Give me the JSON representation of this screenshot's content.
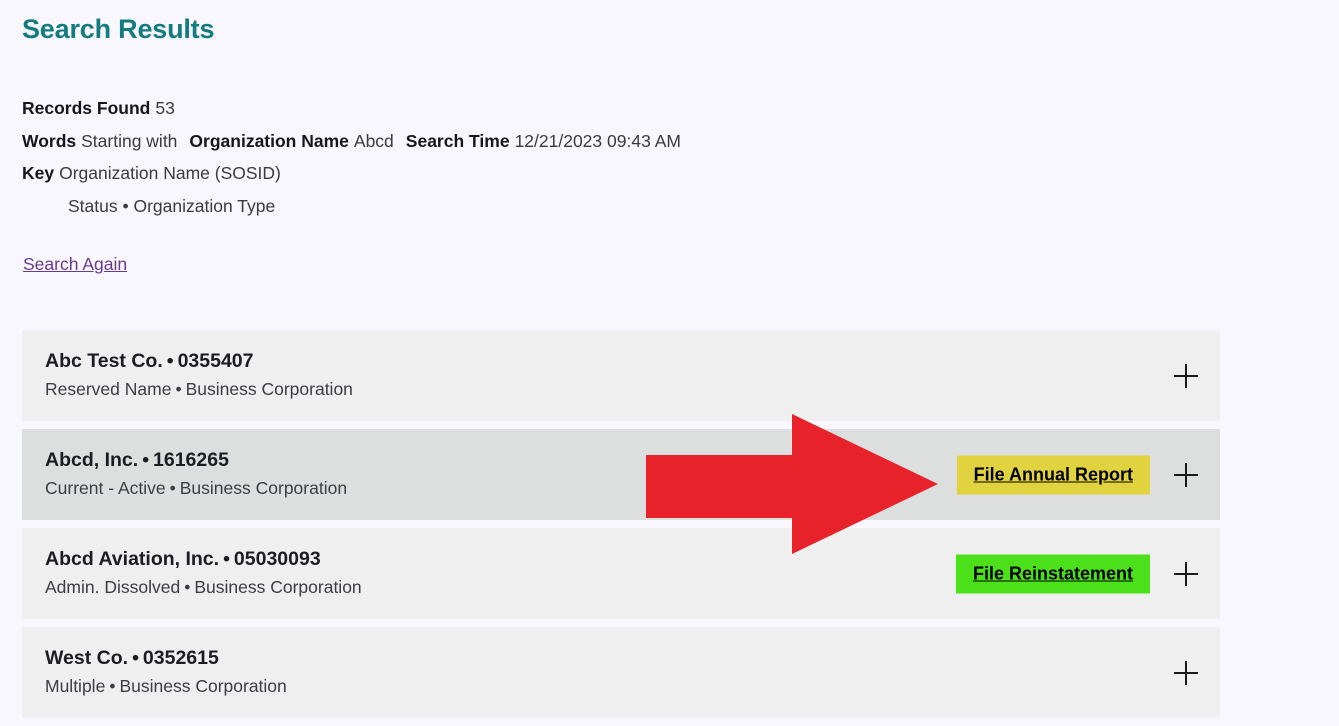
{
  "page": {
    "title": "Search Results",
    "background_color": "#f8f7fd",
    "title_color": "#147b80"
  },
  "summary": {
    "records_found_label": "Records Found",
    "records_found_value": "53",
    "words_label": "Words",
    "words_value": "Starting with",
    "organization_name_label": "Organization Name",
    "organization_name_value": "Abcd",
    "search_time_label": "Search Time",
    "search_time_value": "12/21/2023 09:43 AM",
    "key_label": "Key",
    "key_value": "Organization Name (SOSID)",
    "key_value_line2": "Status • Organization Type",
    "search_again_link": "Search Again",
    "search_again_color": "#6a3b8c"
  },
  "results": [
    {
      "name": "Abc Test Co.",
      "separator": "•",
      "sosid": "0355407",
      "status": "Reserved Name",
      "type": "Business Corporation",
      "action": null,
      "expand_icon": "plus-icon"
    },
    {
      "name": "Abcd, Inc.",
      "separator": "•",
      "sosid": "1616265",
      "status": "Current - Active",
      "type": "Business Corporation",
      "action": "File Annual Report",
      "action_color": "#e0d33f",
      "expand_icon": "plus-icon"
    },
    {
      "name": "Abcd Aviation, Inc.",
      "separator": "•",
      "sosid": "05030093",
      "status": "Admin. Dissolved",
      "type": "Business Corporation",
      "action": "File Reinstatement",
      "action_color": "#4ce01b",
      "expand_icon": "plus-icon"
    },
    {
      "name": "West Co.",
      "separator": "•",
      "sosid": "0352615",
      "status": "Multiple",
      "type": "Business Corporation",
      "action": null,
      "expand_icon": "plus-icon"
    }
  ],
  "annotation": {
    "type": "arrow",
    "direction": "right",
    "color": "#e8222a",
    "points_to": "File Annual Report"
  }
}
